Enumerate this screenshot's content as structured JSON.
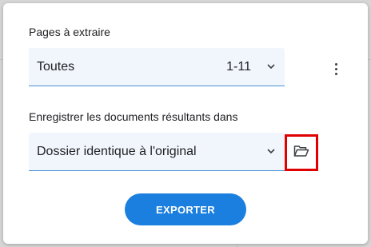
{
  "dialog": {
    "pages_section": {
      "label": "Pages à extraire",
      "selected_value": "Toutes",
      "range": "1-11",
      "icon": "chevron-down-icon"
    },
    "more_options_icon": "more-vertical-icon",
    "save_section": {
      "label": "Enregistrer les documents résultants dans",
      "selected_value": "Dossier identique à l'original",
      "icon": "chevron-down-icon",
      "folder_icon": "folder-open-icon"
    },
    "export_button_label": "EXPORTER"
  },
  "colors": {
    "accent": "#1a7fde",
    "select_background": "#f1f6fc",
    "select_underline": "#4a90d9",
    "highlight_border": "#e00000"
  }
}
